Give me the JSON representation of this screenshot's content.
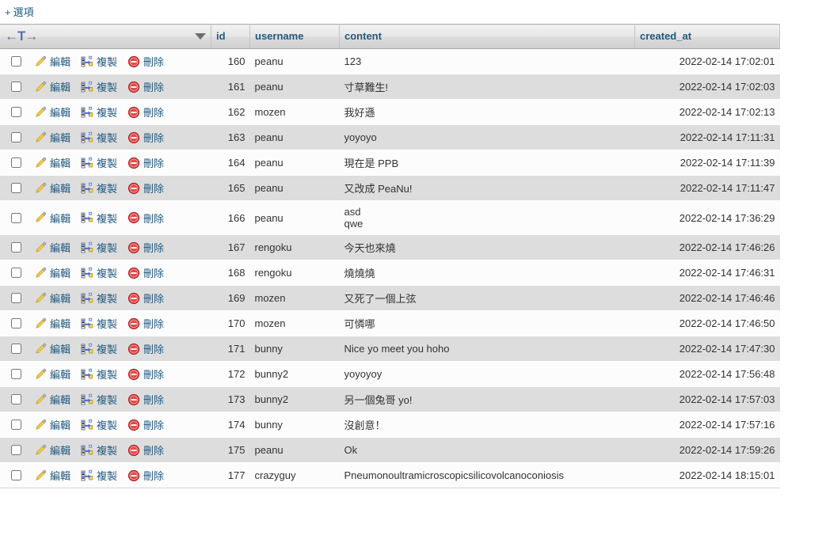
{
  "toolbar": {
    "options_plus": "+",
    "options_label": "選項"
  },
  "table": {
    "nav_arrows": "←T→",
    "columns": [
      {
        "key": "actions",
        "label": ""
      },
      {
        "key": "id",
        "label": "id"
      },
      {
        "key": "username",
        "label": "username"
      },
      {
        "key": "content",
        "label": "content"
      },
      {
        "key": "created_at",
        "label": "created_at"
      }
    ],
    "row_actions": {
      "edit_label": "編輯",
      "copy_label": "複製",
      "delete_label": "刪除",
      "edit_icon": "pencil-icon",
      "copy_icon": "copy-icon",
      "delete_icon": "delete-icon"
    },
    "rows": [
      {
        "id": "160",
        "username": "peanu",
        "content": "123",
        "created_at": "2022-02-14 17:02:01"
      },
      {
        "id": "161",
        "username": "peanu",
        "content": "寸草難生!",
        "created_at": "2022-02-14 17:02:03"
      },
      {
        "id": "162",
        "username": "mozen",
        "content": "我好遜",
        "created_at": "2022-02-14 17:02:13"
      },
      {
        "id": "163",
        "username": "peanu",
        "content": "yoyoyo",
        "created_at": "2022-02-14 17:11:31"
      },
      {
        "id": "164",
        "username": "peanu",
        "content": "現在是 PPB",
        "created_at": "2022-02-14 17:11:39"
      },
      {
        "id": "165",
        "username": "peanu",
        "content": "又改成 PeaNu!",
        "created_at": "2022-02-14 17:11:47"
      },
      {
        "id": "166",
        "username": "peanu",
        "content": "asd\nqwe",
        "created_at": "2022-02-14 17:36:29"
      },
      {
        "id": "167",
        "username": "rengoku",
        "content": "今天也來燒",
        "created_at": "2022-02-14 17:46:26"
      },
      {
        "id": "168",
        "username": "rengoku",
        "content": "燒燒燒",
        "created_at": "2022-02-14 17:46:31"
      },
      {
        "id": "169",
        "username": "mozen",
        "content": "又死了一個上弦",
        "created_at": "2022-02-14 17:46:46"
      },
      {
        "id": "170",
        "username": "mozen",
        "content": "可憐哪",
        "created_at": "2022-02-14 17:46:50"
      },
      {
        "id": "171",
        "username": "bunny",
        "content": "Nice yo meet you hoho",
        "created_at": "2022-02-14 17:47:30"
      },
      {
        "id": "172",
        "username": "bunny2",
        "content": "yoyoyoy",
        "created_at": "2022-02-14 17:56:48"
      },
      {
        "id": "173",
        "username": "bunny2",
        "content": "另一個兔哥 yo!",
        "created_at": "2022-02-14 17:57:03"
      },
      {
        "id": "174",
        "username": "bunny",
        "content": "沒創意！",
        "created_at": "2022-02-14 17:57:16"
      },
      {
        "id": "175",
        "username": "peanu",
        "content": "Ok",
        "created_at": "2022-02-14 17:59:26"
      },
      {
        "id": "177",
        "username": "crazyguy",
        "content": "Pneumonoultramicroscopicsilicovolcanoconiosis",
        "created_at": "2022-02-14 18:15:01"
      }
    ]
  },
  "colors": {
    "link": "#235a81",
    "header_text": "#235a81",
    "row_even_bg": "#dddddd",
    "row_odd_bg": "#fcfcfd",
    "delete_icon": "#d13b3b",
    "pencil_icon": "#e8c14a",
    "copy_icon": "#3b5fc0"
  }
}
